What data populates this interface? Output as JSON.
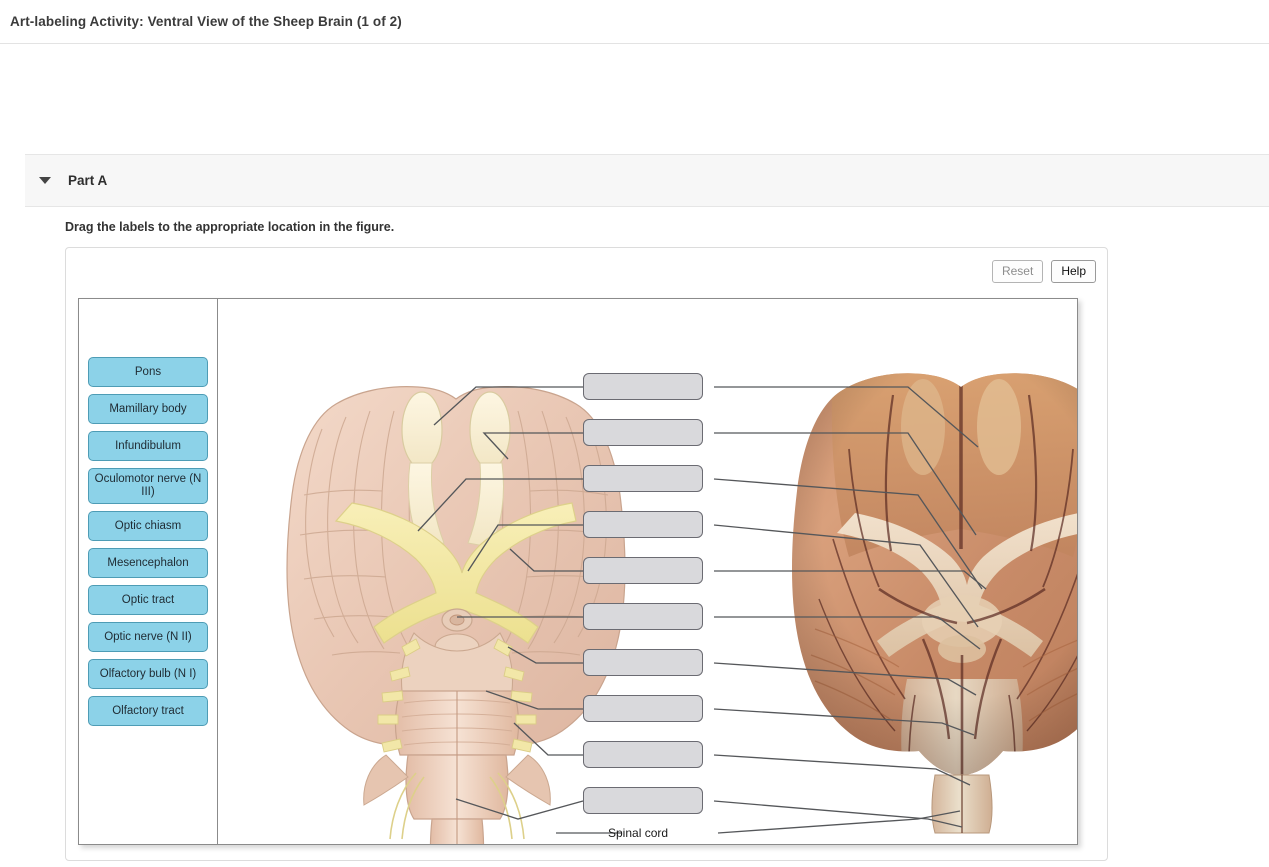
{
  "header": {
    "title": "Art-labeling Activity: Ventral View of the Sheep Brain (1 of 2)"
  },
  "part": {
    "caret_icon": "caret-down-icon",
    "label": "Part A"
  },
  "instruction": "Drag the labels to the appropriate location in the figure.",
  "toolbar": {
    "reset_label": "Reset",
    "reset_disabled": true,
    "help_label": "Help"
  },
  "label_bank": {
    "items": [
      {
        "text": "Pons",
        "lines": 1
      },
      {
        "text": "Mamillary body",
        "lines": 1
      },
      {
        "text": "Infundibulum",
        "lines": 1
      },
      {
        "text": "Oculomotor nerve (N III)",
        "lines": 2
      },
      {
        "text": "Optic chiasm",
        "lines": 1
      },
      {
        "text": "Mesencephalon",
        "lines": 1
      },
      {
        "text": "Optic tract",
        "lines": 1
      },
      {
        "text": "Optic nerve (N II)",
        "lines": 1
      },
      {
        "text": "Olfactory bulb (N I)",
        "lines": 1
      },
      {
        "text": "Olfactory tract",
        "lines": 1
      }
    ]
  },
  "figure": {
    "drop_zones": [
      {
        "id": 1,
        "value": ""
      },
      {
        "id": 2,
        "value": ""
      },
      {
        "id": 3,
        "value": ""
      },
      {
        "id": 4,
        "value": ""
      },
      {
        "id": 5,
        "value": ""
      },
      {
        "id": 6,
        "value": ""
      },
      {
        "id": 7,
        "value": ""
      },
      {
        "id": 8,
        "value": ""
      },
      {
        "id": 9,
        "value": ""
      },
      {
        "id": 10,
        "value": ""
      }
    ],
    "static_labels": [
      {
        "text": "Spinal cord"
      }
    ]
  },
  "colors": {
    "label_fill": "#8cd2e8",
    "label_border": "#4e9cb5",
    "dropzone_fill": "#d9d9dc",
    "dropzone_border": "#6b6b72",
    "leader_line": "#55575a",
    "part_bar_bg": "#f7f7f7"
  }
}
